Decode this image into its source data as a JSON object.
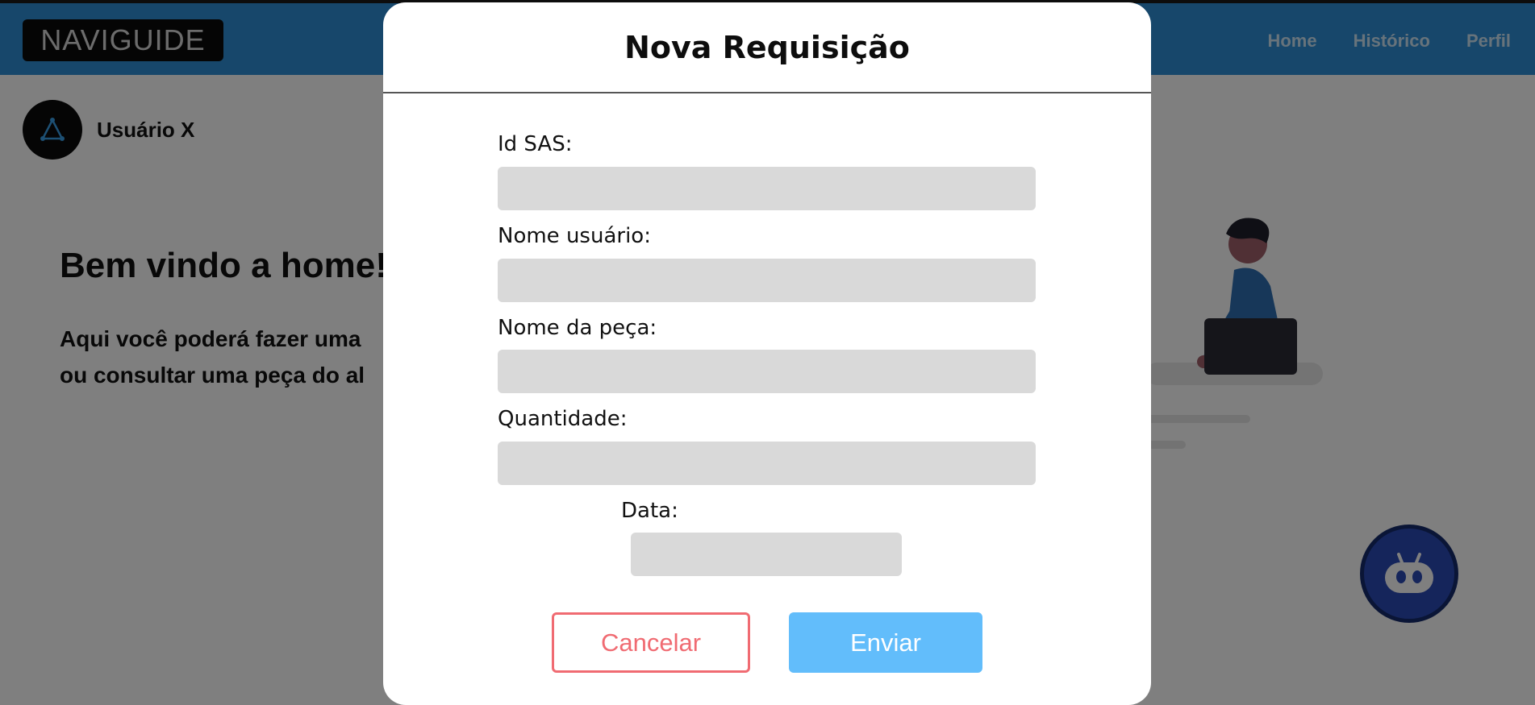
{
  "header": {
    "logo_text": "NAVIGUIDE",
    "nav": [
      "Home",
      "Histórico",
      "Perfil"
    ]
  },
  "user": {
    "name": "Usuário X"
  },
  "home": {
    "welcome": "Bem vindo a home!",
    "intro_line1": "Aqui você poderá fazer uma",
    "intro_line2": "ou consultar uma peça do al"
  },
  "modal": {
    "title": "Nova Requisição",
    "fields": [
      {
        "label": "Id SAS:",
        "value": ""
      },
      {
        "label": "Nome usuário:",
        "value": ""
      },
      {
        "label": "Nome da peça:",
        "value": ""
      },
      {
        "label": "Quantidade:",
        "value": ""
      },
      {
        "label": "Data:",
        "value": ""
      }
    ],
    "cancel_label": "Cancelar",
    "send_label": "Enviar"
  },
  "colors": {
    "header": "#2e8fd6",
    "cancel": "#f06b72",
    "send": "#62bdfb",
    "input_bg": "#d9d9d9"
  },
  "icons": {
    "avatar": "triangle-network-icon",
    "assistant": "robot-icon"
  }
}
